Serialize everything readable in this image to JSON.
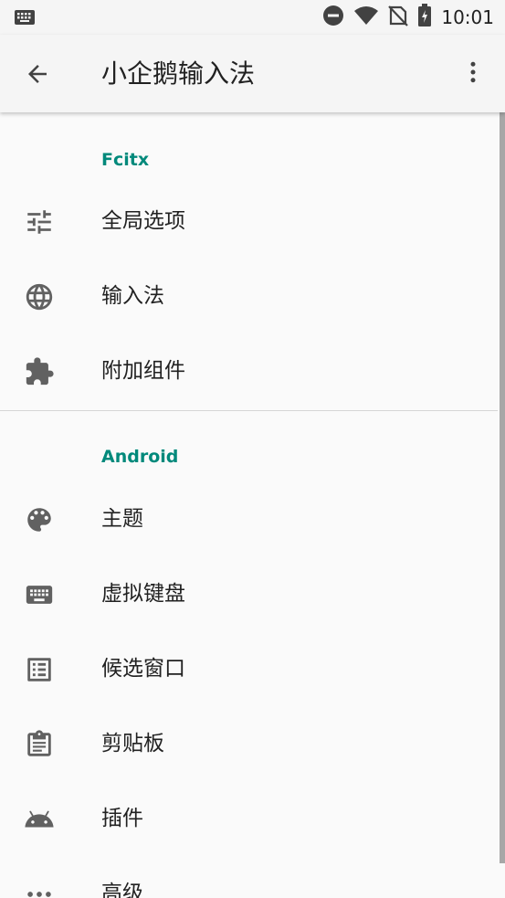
{
  "status_bar": {
    "time": "10:01",
    "icons": [
      "keyboard-icon",
      "dnd-icon",
      "wifi-icon",
      "no-sim-icon",
      "battery-charging-icon"
    ]
  },
  "app_bar": {
    "title": "小企鹅输入法",
    "back_icon": "arrow-back-icon",
    "more_icon": "more-vert-icon"
  },
  "sections": [
    {
      "header": "Fcitx",
      "items": [
        {
          "label": "全局选项",
          "icon": "tune-icon"
        },
        {
          "label": "输入法",
          "icon": "globe-icon"
        },
        {
          "label": "附加组件",
          "icon": "extension-icon"
        }
      ]
    },
    {
      "header": "Android",
      "items": [
        {
          "label": "主题",
          "icon": "palette-icon"
        },
        {
          "label": "虚拟键盘",
          "icon": "keyboard-icon"
        },
        {
          "label": "候选窗口",
          "icon": "list-icon"
        },
        {
          "label": "剪贴板",
          "icon": "clipboard-icon"
        },
        {
          "label": "插件",
          "icon": "android-icon"
        },
        {
          "label": "高级",
          "icon": "more-horiz-icon"
        }
      ]
    }
  ],
  "colors": {
    "accent": "#00897b",
    "icon": "#616161",
    "background": "#fafafa",
    "app_bar": "#f5f5f5"
  }
}
